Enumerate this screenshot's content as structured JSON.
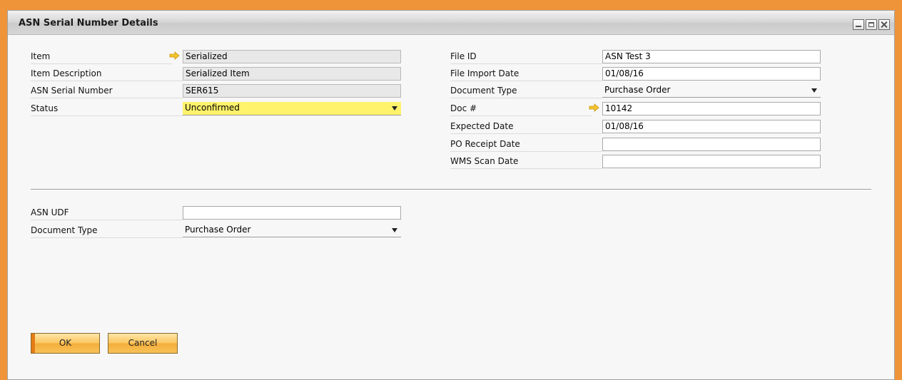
{
  "window": {
    "title": "ASN Serial Number Details"
  },
  "left": {
    "item_label": "Item",
    "item_value": "Serialized",
    "item_desc_label": "Item Description",
    "item_desc_value": "Serialized Item",
    "serial_label": "ASN Serial Number",
    "serial_value": "SER615",
    "status_label": "Status",
    "status_value": "Unconfirmed"
  },
  "right": {
    "file_id_label": "File ID",
    "file_id_value": "ASN Test 3",
    "import_date_label": "File Import Date",
    "import_date_value": "01/08/16",
    "doc_type_label": "Document Type",
    "doc_type_value": "Purchase Order",
    "doc_num_label": "Doc #",
    "doc_num_value": "10142",
    "expected_date_label": "Expected Date",
    "expected_date_value": "01/08/16",
    "po_receipt_label": "PO Receipt Date",
    "po_receipt_value": "",
    "wms_scan_label": "WMS Scan Date",
    "wms_scan_value": ""
  },
  "udf": {
    "asn_udf_label": "ASN UDF",
    "asn_udf_value": "",
    "doc_type_label": "Document Type",
    "doc_type_value": "Purchase Order"
  },
  "buttons": {
    "ok": "OK",
    "cancel": "Cancel"
  },
  "colors": {
    "frame": "#f0943a",
    "status_highlight": "#fff36b",
    "button": "#fbc55e",
    "link_arrow": "#f4c430"
  }
}
